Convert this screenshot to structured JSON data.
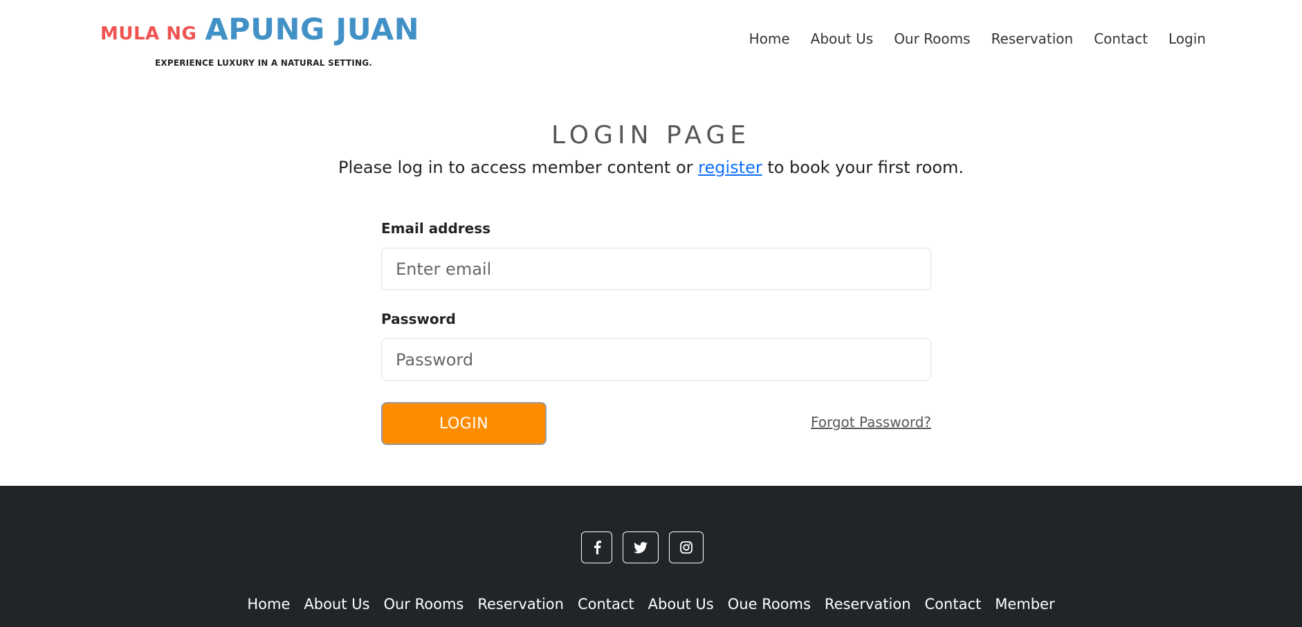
{
  "brand": {
    "prefix": "MULA NG",
    "name": "APUNG JUAN",
    "tagline": "EXPERIENCE LUXURY IN A NATURAL SETTING."
  },
  "nav": {
    "items": [
      "Home",
      "About Us",
      "Our Rooms",
      "Reservation",
      "Contact",
      "Login"
    ]
  },
  "main": {
    "title": "LOGIN PAGE",
    "subtitle_before": "Please log in to access member content or ",
    "register_link": "register",
    "subtitle_after": " to book your first room."
  },
  "form": {
    "email_label": "Email address",
    "email_placeholder": "Enter email",
    "email_value": "",
    "password_label": "Password",
    "password_placeholder": "Password",
    "password_value": "",
    "login_label": "LOGIN",
    "forgot_label": "Forgot Password?"
  },
  "footer": {
    "social_icons": [
      "facebook-icon",
      "twitter-icon",
      "instagram-icon"
    ],
    "nav_items": [
      "Home",
      "About Us",
      "Our Rooms",
      "Reservation",
      "Contact",
      "About Us",
      "Oue Rooms",
      "Reservation",
      "Contact",
      "Member"
    ]
  },
  "colors": {
    "brand_red": "#ef5350",
    "brand_blue": "#4291c6",
    "login_button": "#ff8c00",
    "footer_bg": "#212529",
    "link": "#0d6efd"
  }
}
